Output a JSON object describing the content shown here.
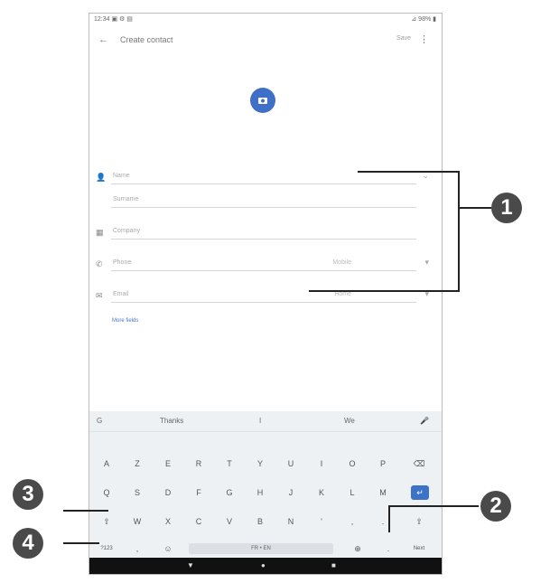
{
  "status_bar": {
    "left": "12:34 ▣ ⚙ ▤",
    "right": "⊿ 98% ▮"
  },
  "app_bar": {
    "back_glyph": "←",
    "title": "Create contact",
    "save_label": "Save",
    "menu_glyph": "⋮"
  },
  "avatar": {
    "icon": "camera-icon"
  },
  "fields": [
    {
      "label": "Name",
      "icon": "person-icon",
      "glyph": "👤",
      "extra": "",
      "chevron": "⌄"
    },
    {
      "label": "Surname",
      "icon": "",
      "glyph": "",
      "extra": "",
      "chevron": ""
    },
    {
      "label": "Company",
      "icon": "business-icon",
      "glyph": "▦",
      "extra": "",
      "chevron": ""
    },
    {
      "label": "Phone",
      "icon": "phone-icon",
      "glyph": "✆",
      "extra": "Mobile",
      "chevron": "▾"
    },
    {
      "label": "Email",
      "icon": "email-icon",
      "glyph": "✉",
      "extra": "Home",
      "chevron": "▾"
    }
  ],
  "more_fields_label": "More fields",
  "keyboard": {
    "suggestions": {
      "left": "G",
      "s1": "Thanks",
      "s2": "I",
      "s3": "We",
      "mic": "🎤"
    },
    "row1": [
      "A",
      "Z",
      "E",
      "R",
      "T",
      "Y",
      "U",
      "I",
      "O",
      "P",
      "⌫"
    ],
    "row2": [
      "Q",
      "S",
      "D",
      "F",
      "G",
      "H",
      "J",
      "K",
      "L",
      "M",
      "↵"
    ],
    "row3": [
      "⇧",
      "W",
      "X",
      "C",
      "V",
      "B",
      "N",
      "'",
      ",",
      ".",
      "⇧"
    ],
    "row4": {
      "sym": "?123",
      "comma": ",",
      "emoji": "☺",
      "space": "FR • EN",
      "globe": "⊕",
      "period": ".",
      "next": "Next"
    }
  },
  "nav_bar": {
    "back": "▼",
    "home": "●",
    "recents": "■"
  },
  "callouts": [
    "1",
    "2",
    "3",
    "4"
  ]
}
